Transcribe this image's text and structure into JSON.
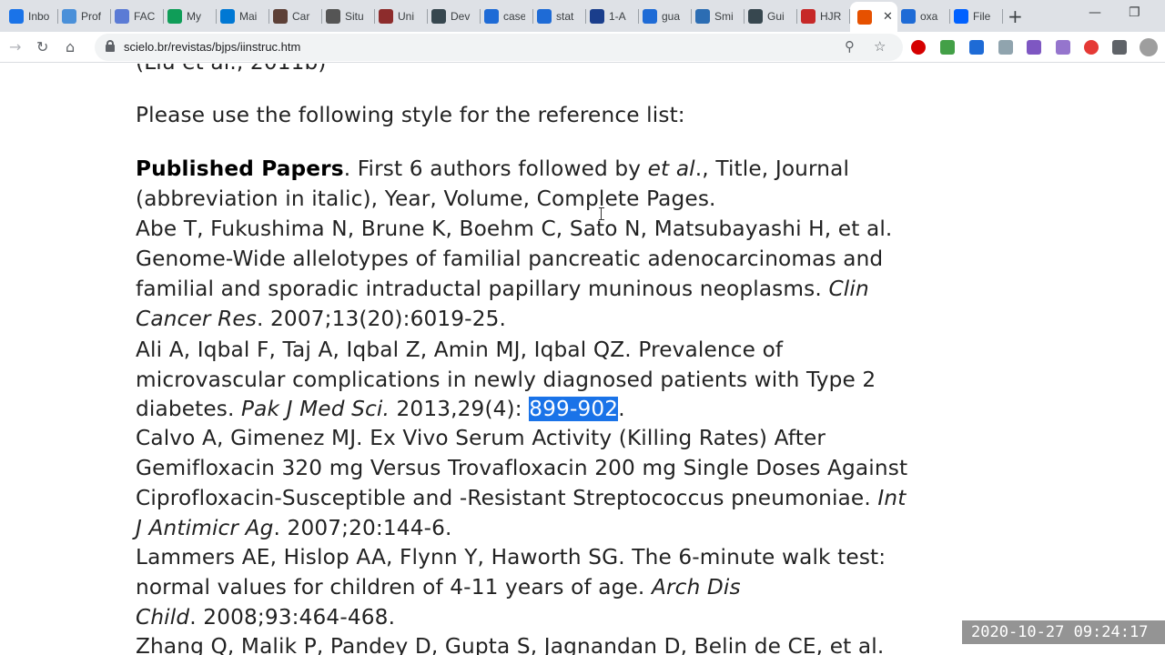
{
  "tabs": [
    {
      "label": "Inbo",
      "icon": "mail-icon",
      "color": "#1a73e8"
    },
    {
      "label": "Prof",
      "icon": "cloud-icon",
      "color": "#4a90d9"
    },
    {
      "label": "FAC",
      "icon": "accessibility-icon",
      "color": "#5b7bd5"
    },
    {
      "label": "My",
      "icon": "drive-icon",
      "color": "#0f9d58"
    },
    {
      "label": "Mai",
      "icon": "outlook-icon",
      "color": "#0078d4"
    },
    {
      "label": "Car",
      "icon": "bank-icon",
      "color": "#5d4037"
    },
    {
      "label": "Situ",
      "icon": "globe-icon",
      "color": "#555555"
    },
    {
      "label": "Uni",
      "icon": "university-icon",
      "color": "#8d2c2c"
    },
    {
      "label": "Dev",
      "icon": "shield-icon",
      "color": "#37474f"
    },
    {
      "label": "case",
      "icon": "cube-icon",
      "color": "#1e6bd6"
    },
    {
      "label": "stat",
      "icon": "cube-icon",
      "color": "#1e6bd6"
    },
    {
      "label": "1-A",
      "icon": "sheet-icon",
      "color": "#1a3e8c"
    },
    {
      "label": "gua",
      "icon": "cube-icon",
      "color": "#1e6bd6"
    },
    {
      "label": "Smi",
      "icon": "mail-icon",
      "color": "#2c6db3"
    },
    {
      "label": "Gui",
      "icon": "shield-icon",
      "color": "#37474f"
    },
    {
      "label": "HJR",
      "icon": "journal-icon",
      "color": "#c62828"
    },
    {
      "label": "",
      "icon": "scielo-icon",
      "color": "#e65100",
      "active": true
    },
    {
      "label": "oxa",
      "icon": "cube-icon",
      "color": "#1e6bd6"
    },
    {
      "label": "File",
      "icon": "dropbox-icon",
      "color": "#0061ff"
    }
  ],
  "toolbar": {
    "url": "scielo.br/revistas/bjps/iinstruc.htm"
  },
  "content": {
    "top_partial": "(Liu et al., 2011b)",
    "intro": "Please use the following style for the reference list:",
    "published_label": "Published Papers",
    "published_desc_1": ". First 6 authors followed by ",
    "published_desc_etal": "et al",
    "published_desc_2": "., Title, Journal",
    "published_desc_3": "(abbreviation in italic), Year, Volume, Complete Pages.",
    "ref1_l1": "Abe T, Fukushima N, Brune K, Boehm C, Sato N, Matsubayashi H, et al.",
    "ref1_l2": "Genome-Wide allelotypes of familial pancreatic adenocarcinomas and",
    "ref1_l3a": "familial and sporadic intraductal papillary muninous neoplasms. ",
    "ref1_l3b": "Clin",
    "ref1_l4a": "Cancer Res",
    "ref1_l4b": ". 2007;13(20):6019-25.",
    "ref2_l1": "Ali A, Iqbal F, Taj A, Iqbal Z, Amin MJ, Iqbal QZ. Prevalence of",
    "ref2_l2": "microvascular complications in newly diagnosed patients with Type 2",
    "ref2_l3a": "diabetes. ",
    "ref2_l3b": "Pak J Med Sci.",
    "ref2_l3c": " 2013,29(4): ",
    "ref2_l3sel": "899-902",
    "ref2_l3d": ".",
    "ref3_l1": "Calvo A, Gimenez MJ. Ex Vivo Serum Activity (Killing Rates) After",
    "ref3_l2": "Gemifloxacin 320 mg Versus Trovafloxacin 200 mg Single Doses Against",
    "ref3_l3a": "Ciprofloxacin-Susceptible and -Resistant Streptococcus pneumoniae. ",
    "ref3_l3b": "Int",
    "ref3_l4a": "J Antimicr Ag",
    "ref3_l4b": ". 2007;20:144-6.",
    "ref4_l1": "Lammers AE, Hislop AA, Flynn Y, Haworth SG. The 6-minute walk test:",
    "ref4_l2a": "normal values for children of 4-11 years of age. ",
    "ref4_l2b": "Arch Dis",
    "ref4_l3a": "Child",
    "ref4_l3b": ". 2008;93:464-468.",
    "ref5_l1": "Zhang Q, Malik P, Pandey D, Gupta S, Jagnandan D, Belin de CE, et al."
  },
  "timestamp": "2020-10-27  09:24:17"
}
